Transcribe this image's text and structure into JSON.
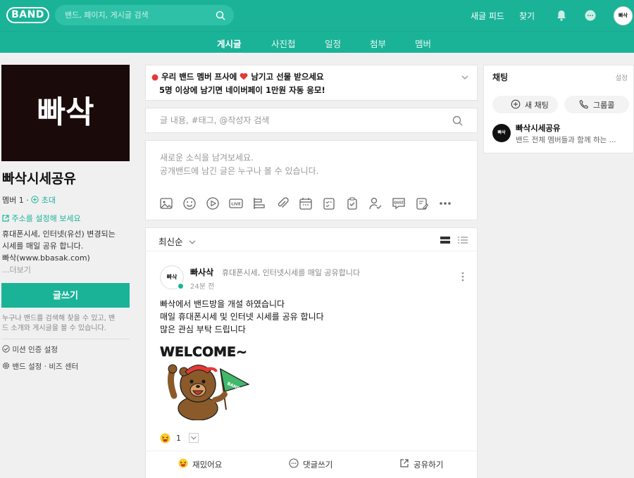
{
  "header": {
    "logo": "BAND",
    "search_placeholder": "밴드, 페이지, 게시글 검색",
    "new_feed": "새글 피드",
    "find": "찾기",
    "avatar_text": "빠삭"
  },
  "tabs": [
    {
      "label": "게시글",
      "active": true
    },
    {
      "label": "사진첩",
      "active": false
    },
    {
      "label": "일정",
      "active": false
    },
    {
      "label": "첨부",
      "active": false
    },
    {
      "label": "멤버",
      "active": false
    }
  ],
  "sidebar": {
    "cover_text": "빠삭",
    "band_name": "빠삭시세공유",
    "members_label": "멤버",
    "members_count": "1",
    "invite": "초대",
    "address_link": "주소를 설정해 보세요",
    "desc_lines": [
      "휴대폰시세, 인터넷(유선) 변경되는",
      "시세를 매일 공유 합니다.",
      "빠삭(www.bbasak.com)"
    ],
    "more": "...더보기",
    "write_button": "글쓰기",
    "hint_lines": [
      "누구나 밴드를 검색해 찾을 수 있고, 밴",
      "드 소개와 게시글을 볼 수 있습니다."
    ],
    "mission": "미션 인증 설정",
    "band_settings": "밴드 설정",
    "biz_center": "비즈 센터"
  },
  "notice": {
    "line1_a": "우리 밴드 멤버 프사에",
    "line1_b": "남기고 선물 받으세요",
    "line2": "5명 이상에 남기면 네이버페이 1만원 자동 응모!"
  },
  "post_search": {
    "placeholder": "글 내용, #태그, @작성자 검색"
  },
  "composer": {
    "line1": "새로운 소식을 남겨보세요.",
    "line2": "공개밴드에 남긴 글은 누구나 볼 수 있습니다."
  },
  "feed": {
    "sort": "최신순",
    "post": {
      "author": "빠사삭",
      "author_desc": "휴대폰시세, 인터넷시세를 매일 공유합니다",
      "time": "24분 전",
      "avatar_text": "빠삭",
      "body": [
        "빠삭에서 밴드방을 개설 하였습니다",
        "매일 휴대폰시세 및 인터넷 시세를 공유 합니다",
        "많은 관심 부탁 드립니다"
      ],
      "sticker_text": "WELCOME~",
      "sticker_flag": "BAND",
      "reaction_count": "1"
    },
    "actions": {
      "fun": "재밌어요",
      "comment": "댓글쓰기",
      "share": "공유하기"
    }
  },
  "chat": {
    "title": "채팅",
    "settings": "설정",
    "new_chat": "새 채팅",
    "group_call": "그룹콜",
    "room_name": "빠삭시세공유",
    "room_desc": "밴드 전체 멤버들과 함께 하는 ...",
    "room_avatar": "빠삭"
  },
  "colors": {
    "accent": "#1bb398",
    "heart": "#e53935"
  }
}
